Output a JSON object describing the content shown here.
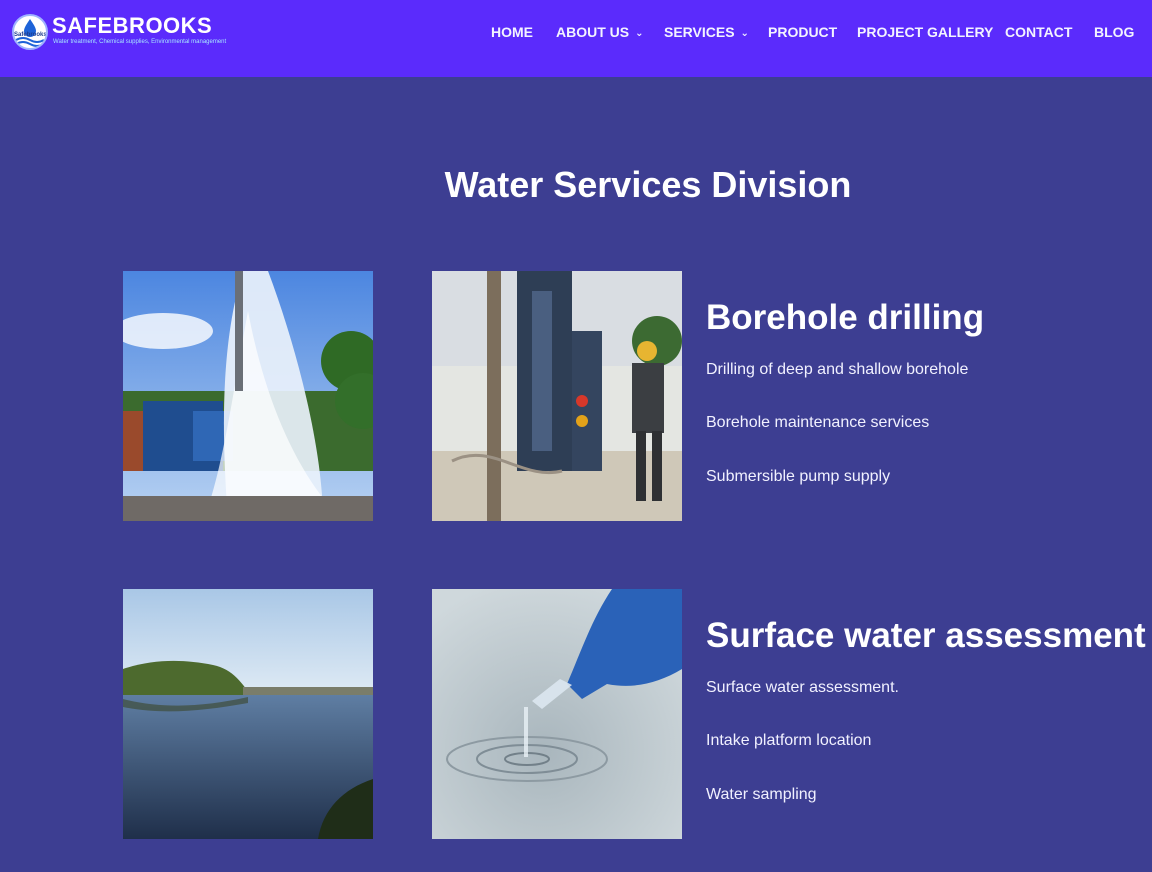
{
  "brand": {
    "name": "SAFEBROOKS",
    "badge_text": "Safebrooks",
    "tagline": "Water treatment, Chemical supplies, Environmental management"
  },
  "nav": {
    "home": "HOME",
    "about": "ABOUT US",
    "services": "SERVICES",
    "product": "PRODUCT",
    "gallery": "PROJECT GALLERY",
    "contact": "CONTACT",
    "blog": "BLOG"
  },
  "page": {
    "title": "Water Services Division"
  },
  "services": [
    {
      "heading": "Borehole drilling",
      "items": [
        "Drilling of deep and shallow borehole",
        "Borehole maintenance services",
        "Submersible pump supply"
      ]
    },
    {
      "heading": "Surface water assessment",
      "items": [
        "Surface water assessment.",
        "Intake platform location",
        "Water sampling"
      ]
    }
  ],
  "colors": {
    "header_bg": "#5b2bfc",
    "page_bg": "#3d3e92",
    "text": "#ffffff"
  }
}
